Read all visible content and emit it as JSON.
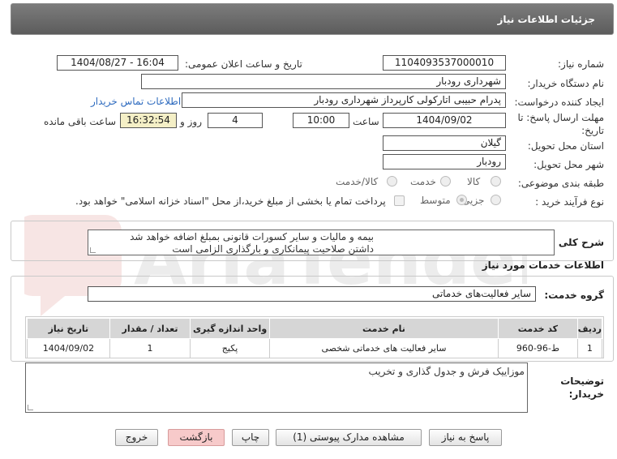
{
  "header": {
    "title": "جزئیات اطلاعات نیاز"
  },
  "form": {
    "need_number_label": "شماره نیاز:",
    "need_number": "1104093537000010",
    "announce_label": "تاریخ و ساعت اعلان عمومی:",
    "announce_value": "1404/08/27 - 16:04",
    "buyer_org_label": "نام دستگاه خریدار:",
    "buyer_org": "شهرداری رودبار",
    "creator_label": "ایجاد کننده درخواست:",
    "creator": "پدرام حبیبی اتارکولی کارپرداز شهرداری رودبار",
    "contact_link": "اطلاعات تماس خریدار",
    "deadline_label_1": "مهلت ارسال پاسخ: تا",
    "deadline_label_2": "تاریخ:",
    "deadline_date": "1404/09/02",
    "time_label": "ساعت",
    "deadline_time": "10:00",
    "days_value": "4",
    "days_label": "روز و",
    "remaining_time": "16:32:54",
    "remaining_label": "ساعت باقی مانده",
    "province_label": "استان محل تحویل:",
    "province": "گیلان",
    "city_label": "شهر محل تحویل:",
    "city": "رودبار",
    "category_label": "طبقه بندی موضوعی:",
    "category_options": [
      "کالا",
      "خدمت",
      "کالا/خدمت"
    ],
    "process_label": "نوع فرآیند خرید :",
    "process_options": [
      "جزیی",
      "متوسط"
    ],
    "payment_note": "پرداخت تمام یا بخشی از مبلغ خرید،از محل \"اسناد خزانه اسلامی\" خواهد بود."
  },
  "description": {
    "label": "شرح کلی نیاز:",
    "line1": "بیمه و مالیات و سایر کسورات قانونی بمبلغ اضافه خواهد شد",
    "line2": "داشتن صلاحیت پیمانکاری و بارگذاری الزامی است"
  },
  "services": {
    "section_title": "اطلاعات خدمات مورد نیاز",
    "group_label": "گروه خدمت:",
    "group_value": "سایر فعالیت‌های خدماتی",
    "columns": [
      "ردیف",
      "کد خدمت",
      "نام خدمت",
      "واحد اندازه گیری",
      "تعداد / مقدار",
      "تاریخ نیاز"
    ],
    "rows": [
      {
        "index": "1",
        "code": "ط-96-960",
        "name": "سایر فعالیت های خدماتی شخصی",
        "unit": "پکیج",
        "qty": "1",
        "date": "1404/09/02"
      }
    ]
  },
  "buyer_notes": {
    "label_1": "توضیحات",
    "label_2": "خریدار:",
    "text": "موزاییک فرش و جدول گذاری و تخریب"
  },
  "buttons": {
    "reply": "پاسخ به نیاز",
    "attachments": "مشاهده مدارک پیوستی (1)",
    "print": "چاپ",
    "back": "بازگشت",
    "exit": "خروج"
  },
  "watermark": {
    "text": "AriaTender.net"
  },
  "colors": {
    "header_bg": "#6b6b6b",
    "link": "#2e6bbf",
    "remaining_bg": "#f4efc6",
    "exit_button": "#f7caca"
  }
}
